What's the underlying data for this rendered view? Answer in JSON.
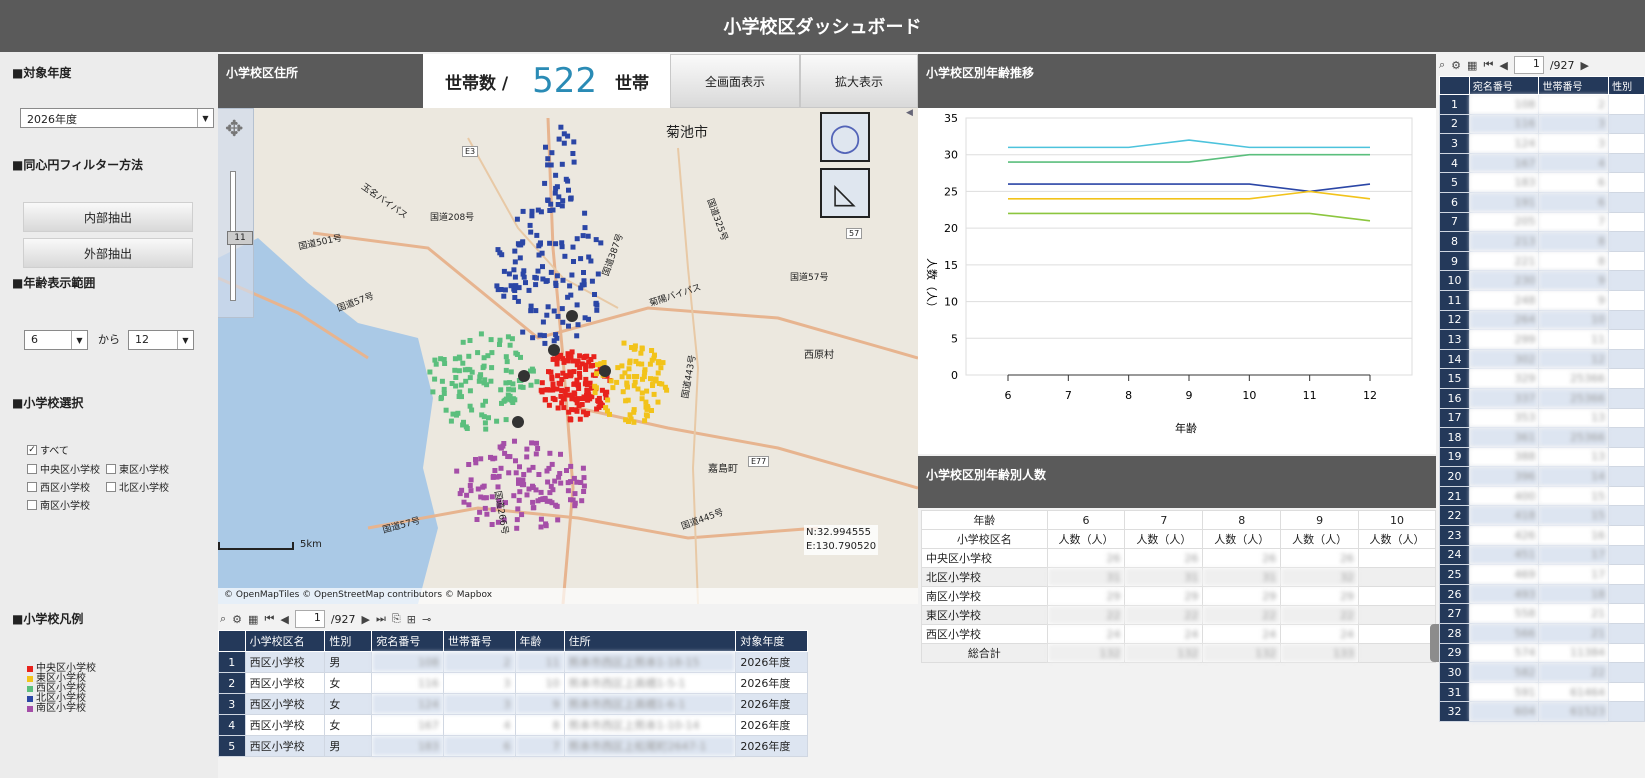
{
  "title": "小学校区ダッシュボード",
  "left": {
    "year_title": "■対象年度",
    "year_value": "2026年度",
    "filter_title": "■同心円フィルター方法",
    "btn_inner": "内部抽出",
    "btn_outer": "外部抽出",
    "age_title": "■年齢表示範囲",
    "age_from": "6",
    "age_kara": "から",
    "age_to": "12",
    "school_title": "■小学校選択",
    "cb_all": "すべて",
    "cb_chuo": "中央区小学校",
    "cb_higashi": "東区小学校",
    "cb_nishi": "西区小学校",
    "cb_kita": "北区小学校",
    "cb_minami": "南区小学校",
    "legend_title": "■小学校凡例",
    "legend": [
      {
        "label": "中央区小学校",
        "color": "#e8221c"
      },
      {
        "label": "東区小学校",
        "color": "#f2c31a"
      },
      {
        "label": "西区小学校",
        "color": "#5bbf7d"
      },
      {
        "label": "北区小学校",
        "color": "#2b46a6"
      },
      {
        "label": "南区小学校",
        "color": "#a54ea8"
      }
    ]
  },
  "map": {
    "header": "小学校区住所",
    "count_label": "世帯数 /",
    "count_value": "522",
    "count_unit": "世帯",
    "btn_full": "全画面表示",
    "btn_zoom": "拡大表示",
    "zoom_level": "11",
    "scale": "5km",
    "coord_n": "N:32.994555",
    "coord_e": "E:130.790520",
    "attribution": "© OpenMapTiles © OpenStreetMap contributors © Mapbox",
    "labels": {
      "kikuchi": "菊池市",
      "kashima": "嘉島町",
      "nishihara": "西原村",
      "r208": "国道208号",
      "r501": "国道501号",
      "r387": "国道387号",
      "r325": "国道325号",
      "r57a": "国道57号",
      "r57b": "国道57号",
      "r57c": "国道57号",
      "r443": "国道443号",
      "r445": "国道445号",
      "r266": "国道266号",
      "tamana": "玉名バイパス",
      "kumamoto_bp": "菊陽バイパス",
      "e3": "E3",
      "e77": "E77",
      "n57": "57"
    }
  },
  "pager": {
    "page": "1",
    "total": "/927"
  },
  "bottom_table": {
    "headers": [
      "",
      "小学校区名",
      "性別",
      "宛名番号",
      "世帯番号",
      "年齢",
      "住所",
      "対象年度"
    ],
    "rows": [
      {
        "i": "1",
        "school": "西区小学校",
        "sex": "男",
        "a": "108",
        "b": "2",
        "age": "11",
        "addr": "熊本市西区上熊本1-18-15",
        "year": "2026年度"
      },
      {
        "i": "2",
        "school": "西区小学校",
        "sex": "女",
        "a": "116",
        "b": "3",
        "age": "10",
        "addr": "熊本市西区上高橋1-5-1",
        "year": "2026年度"
      },
      {
        "i": "3",
        "school": "西区小学校",
        "sex": "女",
        "a": "124",
        "b": "3",
        "age": "9",
        "addr": "熊本市西区上高橋1-6-1",
        "year": "2026年度"
      },
      {
        "i": "4",
        "school": "西区小学校",
        "sex": "女",
        "a": "167",
        "b": "4",
        "age": "8",
        "addr": "熊本市西区上熊本1-10-14",
        "year": "2026年度"
      },
      {
        "i": "5",
        "school": "西区小学校",
        "sex": "男",
        "a": "183",
        "b": "6",
        "age": "7",
        "addr": "熊本市西区上松尾町2647-1",
        "year": "2026年度"
      }
    ]
  },
  "chart": {
    "header": "小学校区別年齢推移",
    "ylabel": "人数（人）",
    "xlabel": "年齢"
  },
  "chart_data": {
    "type": "line",
    "x": [
      6,
      7,
      8,
      9,
      10,
      11,
      12
    ],
    "xlabel": "年齢",
    "ylabel": "人数（人）",
    "ylim": [
      0,
      35
    ],
    "yticks": [
      0,
      5,
      10,
      15,
      20,
      25,
      30,
      35
    ],
    "grid": true,
    "series": [
      {
        "values": [
          31,
          31,
          31,
          32,
          31,
          31,
          31
        ],
        "color": "#4cc3dc"
      },
      {
        "values": [
          29,
          29,
          29,
          29,
          30,
          30,
          30
        ],
        "color": "#5bbf7d"
      },
      {
        "values": [
          26,
          26,
          26,
          26,
          26,
          25,
          26
        ],
        "color": "#2b46a6"
      },
      {
        "values": [
          24,
          24,
          24,
          24,
          24,
          25,
          24
        ],
        "color": "#f2c31a"
      },
      {
        "values": [
          22,
          22,
          22,
          22,
          22,
          22,
          21
        ],
        "color": "#8cc63f"
      }
    ]
  },
  "mid_table": {
    "header": "小学校区別年齢別人数",
    "age_label": "年齢",
    "name_label": "小学校区名",
    "ages": [
      "6",
      "7",
      "8",
      "9",
      "10"
    ],
    "unit": "人数（人）",
    "rows": [
      {
        "name": "中央区小学校",
        "v": [
          "26",
          "26",
          "26",
          "26",
          ""
        ]
      },
      {
        "name": "北区小学校",
        "v": [
          "31",
          "31",
          "31",
          "32",
          ""
        ]
      },
      {
        "name": "南区小学校",
        "v": [
          "29",
          "29",
          "29",
          "29",
          ""
        ]
      },
      {
        "name": "東区小学校",
        "v": [
          "22",
          "22",
          "22",
          "22",
          ""
        ]
      },
      {
        "name": "西区小学校",
        "v": [
          "24",
          "24",
          "24",
          "24",
          ""
        ]
      }
    ],
    "total_label": "総合計",
    "totals": [
      "132",
      "132",
      "132",
      "133",
      ""
    ]
  },
  "right_table": {
    "page": "1",
    "total": "/927",
    "headers": [
      "",
      "宛名番号",
      "世帯番号",
      "性別"
    ],
    "rows": [
      [
        "1",
        "108",
        "2"
      ],
      [
        "2",
        "116",
        "3"
      ],
      [
        "3",
        "124",
        "3"
      ],
      [
        "4",
        "167",
        "4"
      ],
      [
        "5",
        "183",
        "6"
      ],
      [
        "6",
        "191",
        "6"
      ],
      [
        "7",
        "205",
        "7"
      ],
      [
        "8",
        "213",
        "8"
      ],
      [
        "9",
        "221",
        "8"
      ],
      [
        "10",
        "230",
        "9"
      ],
      [
        "11",
        "248",
        "9"
      ],
      [
        "12",
        "264",
        "10"
      ],
      [
        "13",
        "299",
        "11"
      ],
      [
        "14",
        "302",
        "12"
      ],
      [
        "15",
        "329",
        "25366"
      ],
      [
        "16",
        "337",
        "25366"
      ],
      [
        "17",
        "353",
        "13"
      ],
      [
        "18",
        "361",
        "25366"
      ],
      [
        "19",
        "388",
        "13"
      ],
      [
        "20",
        "396",
        "14"
      ],
      [
        "21",
        "400",
        "15"
      ],
      [
        "22",
        "418",
        "15"
      ],
      [
        "23",
        "426",
        "16"
      ],
      [
        "24",
        "451",
        "17"
      ],
      [
        "25",
        "469",
        "17"
      ],
      [
        "26",
        "493",
        "18"
      ],
      [
        "27",
        "558",
        "21"
      ],
      [
        "28",
        "566",
        "21"
      ],
      [
        "29",
        "574",
        "11384"
      ],
      [
        "30",
        "582",
        "22"
      ],
      [
        "31",
        "591",
        "61464"
      ],
      [
        "32",
        "604",
        "61523"
      ]
    ]
  }
}
